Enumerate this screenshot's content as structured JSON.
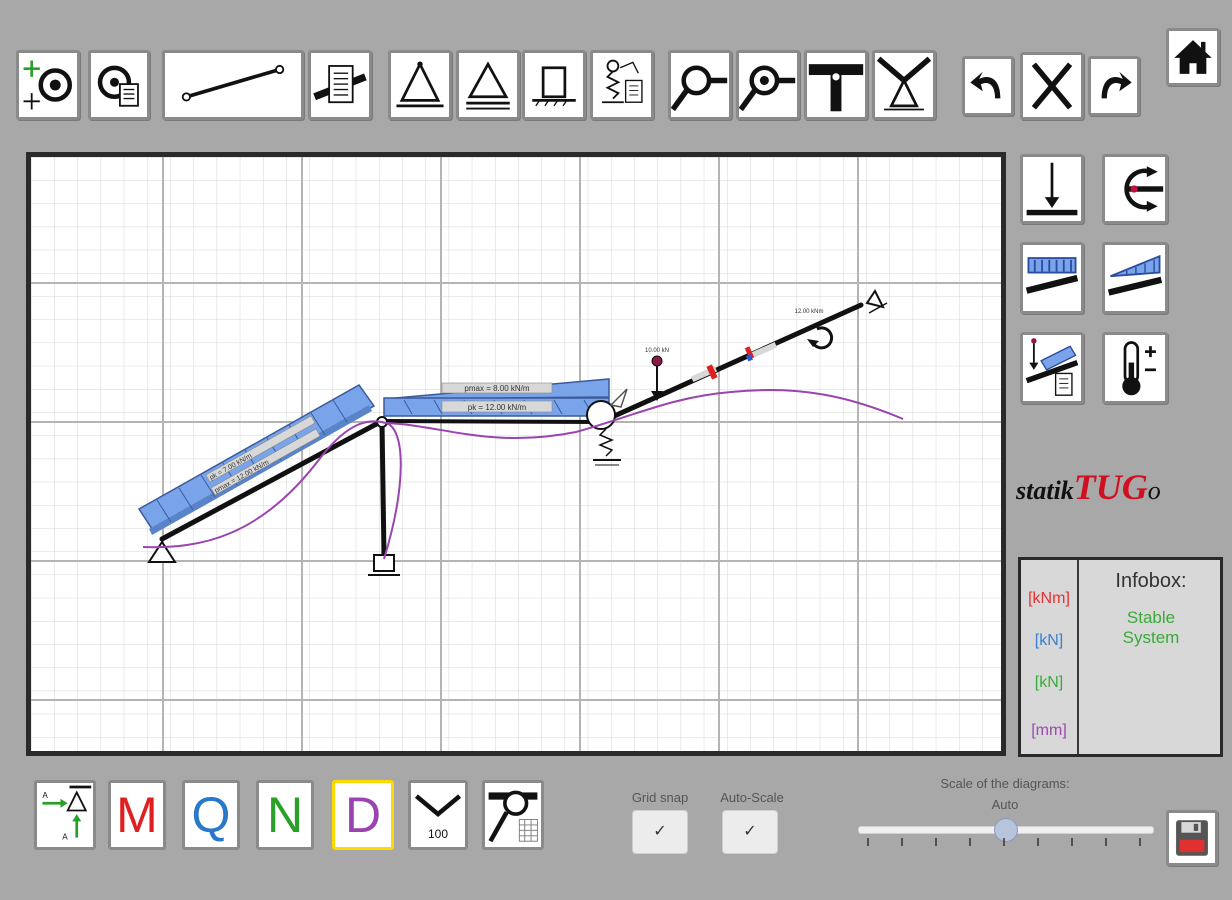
{
  "toolbar": {
    "tools": [
      {
        "name": "add-node-tool",
        "icon": "target-add-icon"
      },
      {
        "name": "node-properties-tool",
        "icon": "node-doc-icon"
      },
      {
        "name": "draw-beam-tool",
        "icon": "beam-line-icon"
      },
      {
        "name": "beam-properties-tool",
        "icon": "beam-doc-icon"
      },
      {
        "name": "pin-support-tool",
        "icon": "pin-support-icon"
      },
      {
        "name": "roller-support-tool",
        "icon": "roller-support-icon"
      },
      {
        "name": "fixed-support-tool",
        "icon": "fixed-support-icon"
      },
      {
        "name": "spring-support-tool",
        "icon": "spring-support-icon"
      },
      {
        "name": "hinge-tool",
        "icon": "hinge-icon"
      },
      {
        "name": "rigid-joint-tool",
        "icon": "rigid-joint-icon"
      },
      {
        "name": "t-joint-tool",
        "icon": "t-joint-icon"
      },
      {
        "name": "angled-support-tool",
        "icon": "angled-support-icon"
      }
    ],
    "undo": "undo-icon",
    "delete": "delete-icon",
    "redo": "redo-icon",
    "home": "home-icon"
  },
  "loads_panel": [
    {
      "name": "point-load-tool",
      "icon": "point-load-icon"
    },
    {
      "name": "moment-load-tool",
      "icon": "moment-load-icon"
    },
    {
      "name": "uniform-load-tool",
      "icon": "uniform-load-icon"
    },
    {
      "name": "trapezoid-load-tool",
      "icon": "trapezoid-load-icon"
    },
    {
      "name": "load-properties-tool",
      "icon": "load-doc-icon"
    },
    {
      "name": "temperature-load-tool",
      "icon": "thermometer-icon"
    }
  ],
  "canvas": {
    "load_labels": {
      "pmax": "pmax = 8.00 kN/m",
      "pk": "pk = 12.00 kN/m",
      "inclined_1": "pk = 7.00 kN/m",
      "inclined_2": "pmax = 12.00 kN/m",
      "point_load": "10.00 kN",
      "moment": "12.00 kNm"
    }
  },
  "brand": {
    "prefix": "statik",
    "main": "TUG",
    "suffix": "o"
  },
  "infobox": {
    "title": "Infobox:",
    "status_line1": "Stable",
    "status_line2": "System",
    "units": [
      {
        "label": "[kNm]",
        "color": "#e53030"
      },
      {
        "label": "[kN]",
        "color": "#3a7fd0"
      },
      {
        "label": "[kN]",
        "color": "#3aaa3a"
      },
      {
        "label": "[mm]",
        "color": "#9a4aaa"
      }
    ]
  },
  "bottom": {
    "diagrams": [
      {
        "name": "reactions-button",
        "label": ""
      },
      {
        "name": "moment-diagram-button",
        "label": "M",
        "color": "#e02020"
      },
      {
        "name": "shear-diagram-button",
        "label": "Q",
        "color": "#2a78c8"
      },
      {
        "name": "normal-diagram-button",
        "label": "N",
        "color": "#2aa02a"
      },
      {
        "name": "deformation-diagram-button",
        "label": "D",
        "color": "#9a44b0"
      }
    ],
    "scale_value_label": "100",
    "grid_snap_label": "Grid snap",
    "auto_scale_label": "Auto-Scale",
    "checkmark": "✓",
    "scale_title": "Scale of the diagrams:",
    "scale_value": "Auto",
    "slider_position": 0.5,
    "save_icon": "floppy-disk-icon"
  },
  "colors": {
    "background": "#a8a8a8",
    "load_fill": "#7aa4ea",
    "deformation": "#9a44b0",
    "brand_red": "#d01020"
  }
}
